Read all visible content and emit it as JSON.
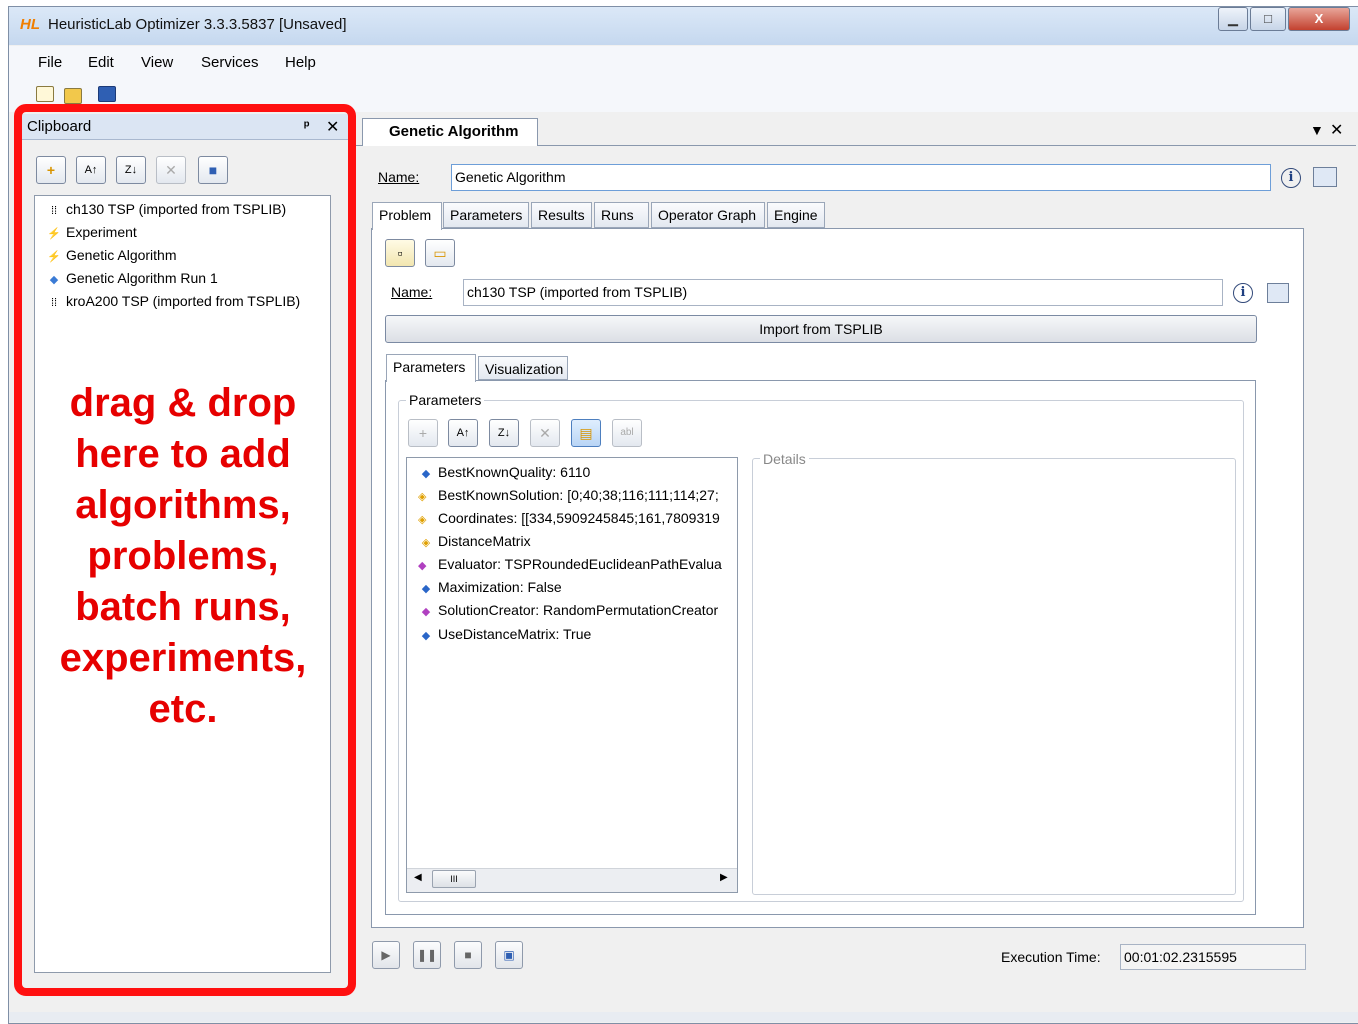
{
  "app": {
    "logo": "HL",
    "title": "HeuristicLab Optimizer 3.3.3.5837 [Unsaved]",
    "window_buttons": {
      "minimize": "▁",
      "maximize": "□",
      "close": "X"
    }
  },
  "menu": [
    "File",
    "Edit",
    "View",
    "Services",
    "Help"
  ],
  "clipboard": {
    "title": "Clipboard",
    "pin": "ᵖ",
    "close": "✕",
    "items": [
      {
        "icon": "grid-icon",
        "label": "ch130 TSP (imported from TSPLIB)"
      },
      {
        "icon": "experiment-icon",
        "label": "Experiment"
      },
      {
        "icon": "algorithm-icon",
        "label": "Genetic Algorithm"
      },
      {
        "icon": "run-icon",
        "label": "Genetic Algorithm Run 1"
      },
      {
        "icon": "grid-icon",
        "label": "kroA200 TSP (imported from TSPLIB)"
      }
    ],
    "overlay": "drag & drop\nhere to add\nalgorithms,\nproblems,\nbatch runs,\nexperiments,\netc."
  },
  "document": {
    "tab_label": "Genetic Algorithm",
    "name_label": "Name:",
    "name_value": "Genetic Algorithm",
    "tabs": [
      "Problem",
      "Parameters",
      "Results",
      "Runs",
      "Operator Graph",
      "Engine"
    ],
    "problem": {
      "name_label": "Name:",
      "name_value": "ch130 TSP (imported from TSPLIB)",
      "import_button": "Import from TSPLIB",
      "subtabs": [
        "Parameters",
        "Visualization"
      ],
      "parameters_group": "Parameters",
      "details_group": "Details",
      "parameters": [
        {
          "icon": "value-icon",
          "label": "BestKnownQuality: 6110"
        },
        {
          "icon": "lookup-icon",
          "label": "BestKnownSolution: [0;40;38;116;111;114;27;"
        },
        {
          "icon": "lookup-icon",
          "label": "Coordinates: [[334,5909245845;161,7809319"
        },
        {
          "icon": "lookup-icon",
          "label": "DistanceMatrix"
        },
        {
          "icon": "operator-icon",
          "label": "Evaluator: TSPRoundedEuclideanPathEvalua"
        },
        {
          "icon": "value-icon",
          "label": "Maximization: False"
        },
        {
          "icon": "operator-icon",
          "label": "SolutionCreator: RandomPermutationCreator"
        },
        {
          "icon": "value-icon",
          "label": "UseDistanceMatrix: True"
        }
      ],
      "scroll_grip": "III"
    },
    "execution_label": "Execution Time:",
    "execution_value": "00:01:02.2315595"
  }
}
